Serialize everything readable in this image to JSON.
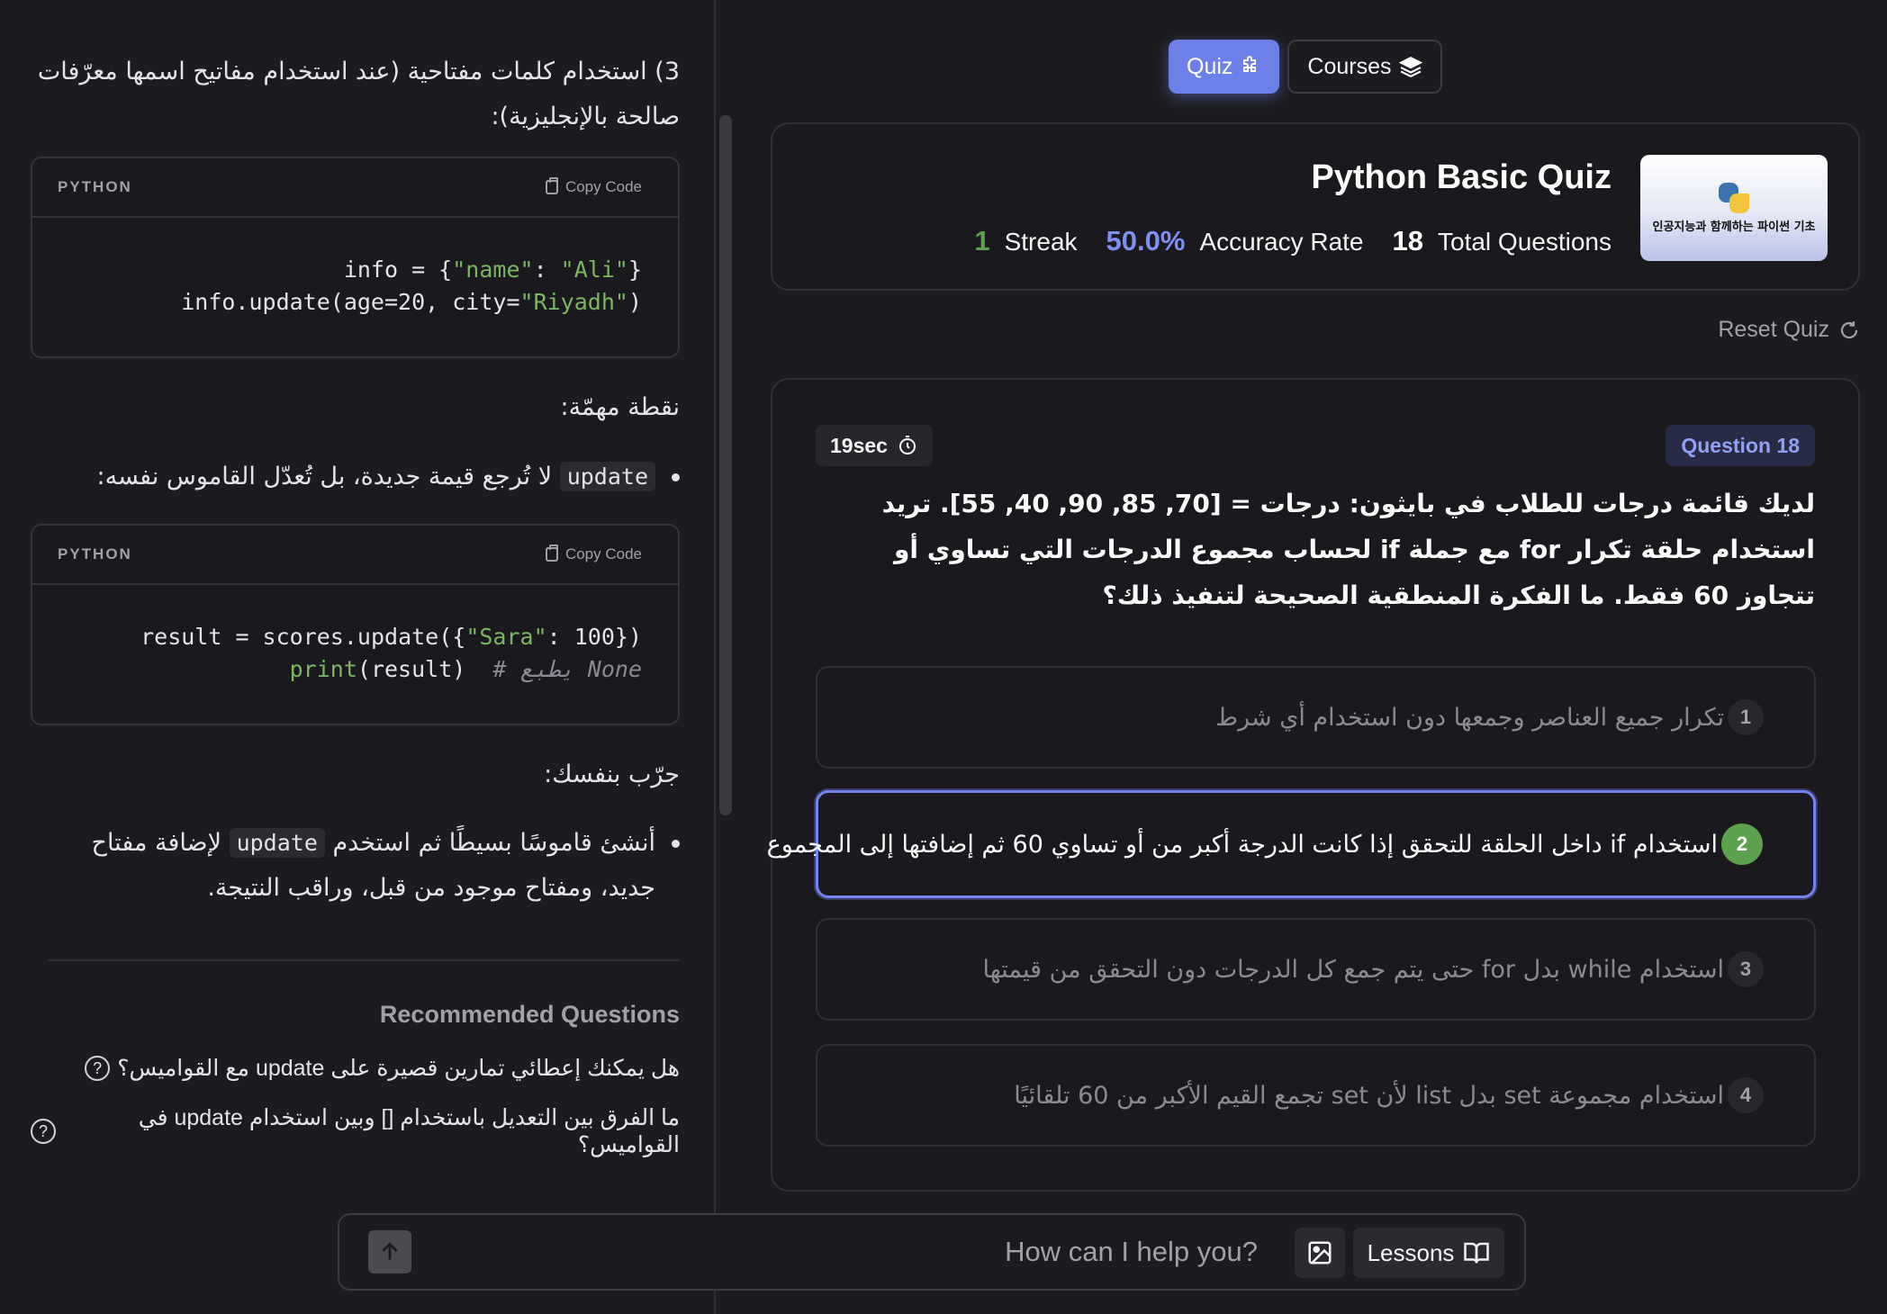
{
  "left_panel": {
    "intro_text": "3) استخدام كلمات مفتاحية (عند استخدام مفاتيح اسمها معرّفات صالحة بالإنجليزية):",
    "code_blocks": [
      {
        "lang": "PYTHON",
        "copy_label": "Copy Code",
        "line1": {
          "a": "info = {",
          "b": "\"name\"",
          "c": ": ",
          "d": "\"Ali\"",
          "e": "}"
        },
        "line2": {
          "a": "info.update(age=20, city=",
          "b": "\"Riyadh\"",
          "c": ")"
        }
      },
      {
        "lang": "PYTHON",
        "copy_label": "Copy Code",
        "line1": {
          "a": "result = scores.update({",
          "b": "\"Sara\"",
          "c": ": 100})"
        },
        "line2": {
          "fn": "print",
          "a": "(result)  ",
          "cmt": "# يطبع None"
        }
      }
    ],
    "important_heading": "نقطة مهمّة:",
    "bullet1": {
      "code": "update",
      "text": " لا تُرجع قيمة جديدة، بل تُعدّل القاموس نفسه:"
    },
    "try_heading": "جرّب بنفسك:",
    "bullet2": {
      "pre": "أنشئ قاموسًا بسيطًا ثم استخدم ",
      "code": "update",
      "post": " لإضافة مفتاح جديد، ومفتاح موجود من قبل، وراقب النتيجة."
    },
    "recommended_title": "Recommended Questions",
    "recommended": [
      "هل يمكنك إعطائي تمارين قصيرة على update مع القواميس؟",
      "ما الفرق بين التعديل باستخدام [] وبين استخدام update في القواميس؟"
    ]
  },
  "tabs": {
    "quiz": "Quiz",
    "courses": "Courses"
  },
  "quiz_header": {
    "title": "Python Basic Quiz",
    "streak_value": "1",
    "streak_label": "Streak",
    "accuracy_value": "50.0%",
    "accuracy_label": "Accuracy Rate",
    "total_value": "18",
    "total_label": "Total Questions",
    "thumbnail_text": "인공지능과 함께하는 파이썬 기초"
  },
  "reset_label": "Reset Quiz",
  "question": {
    "timer": "19sec",
    "badge": "Question 18",
    "text": "لديك قائمة درجات للطلاب في بايثون: درجات = [70, 85, 90, 40, 55]. تريد استخدام حلقة تكرار for مع جملة if لحساب مجموع الدرجات التي تساوي أو تتجاوز 60 فقط. ما الفكرة المنطقية الصحيحة لتنفيذ ذلك؟",
    "options": [
      {
        "num": "1",
        "text": "تكرار جميع العناصر وجمعها دون استخدام أي شرط"
      },
      {
        "num": "2",
        "text": "استخدام if داخل الحلقة للتحقق إذا كانت الدرجة أكبر من أو تساوي 60 ثم إضافتها إلى المجموع"
      },
      {
        "num": "3",
        "text": "استخدام while بدل for حتى يتم جمع كل الدرجات دون التحقق من قيمتها"
      },
      {
        "num": "4",
        "text": "استخدام مجموعة set بدل list لأن set تجمع القيم الأكبر من 60 تلقائيًا"
      }
    ],
    "selected_index": 1
  },
  "chat": {
    "placeholder": "How can I help you?",
    "lessons_label": "Lessons"
  },
  "colors": {
    "accent": "#6d7fe8",
    "success": "#5ba14e",
    "string": "#7bb661"
  }
}
